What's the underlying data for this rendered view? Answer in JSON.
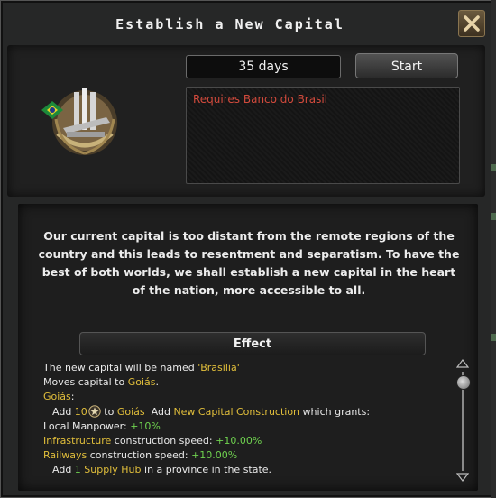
{
  "window": {
    "title": "Establish a New Capital",
    "close_icon": "close-icon"
  },
  "header": {
    "duration": "35 days",
    "start_label": "Start",
    "requirement": "Requires Banco do Brasil"
  },
  "emblem_icon": "national-focus-emblem-icon",
  "description": "Our current capital is too distant from the remote regions of the country and this leads to resentment and separatism. To have the best of both worlds, we shall establish a new capital in the heart of the nation, more accessible to all.",
  "effect": {
    "heading": "Effect",
    "lines": {
      "l1_text": "The new capital will be named ",
      "l1_name": "'Brasília'",
      "l2_text": "Moves capital to ",
      "l2_state": "Goiás",
      "l2_end": ".",
      "l3_state": "Goiás",
      "l3_colon": ":",
      "l4_add": "Add ",
      "l4_num": "10",
      "l4_to": " to ",
      "l4_state": "Goiás",
      "l4_add2": "  Add ",
      "l4_building": "New Capital Construction",
      "l4_end": " which grants:",
      "l5_label": "Local Manpower: ",
      "l5_val": "+10%",
      "l6_name": "Infrastructure",
      "l6_label": " construction speed: ",
      "l6_val": "+10.00%",
      "l7_name": "Railways",
      "l7_label": " construction speed: ",
      "l7_val": "+10.00%",
      "l8_add": "Add ",
      "l8_num": "1",
      "l8_hub": " Supply Hub",
      "l8_end": " in a province in the state."
    }
  },
  "colors": {
    "highlight_yellow": "#e2bf3b",
    "positive_green": "#6fd24f",
    "requirement_red": "#d14a3c"
  }
}
